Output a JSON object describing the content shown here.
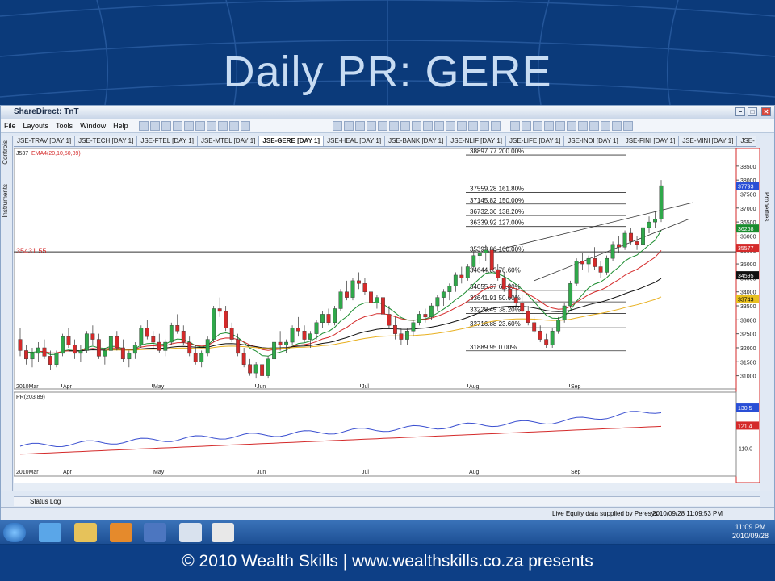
{
  "slide_title": "Daily PR: GERE",
  "footer": "© 2010 Wealth Skills | www.wealthskills.co.za presents",
  "app": {
    "title": "ShareDirect: TnT",
    "menu": [
      "File",
      "Layouts",
      "Tools",
      "Window",
      "Help"
    ],
    "tabs": [
      "JSE-TRAV [DAY 1]",
      "JSE-TECH [DAY 1]",
      "JSE-FTEL [DAY 1]",
      "JSE-MTEL [DAY 1]",
      "JSE-GERE [DAY 1]",
      "JSE-HEAL [DAY 1]",
      "JSE-BANK [DAY 1]",
      "JSE-NLIF [DAY 1]",
      "JSE-LIFE [DAY 1]",
      "JSE-INDI [DAY 1]",
      "JSE-FINI [DAY 1]",
      "JSE-MINI [DAY 1]",
      "JSE-"
    ],
    "active_tab": 4,
    "left_panels": [
      "Controls",
      "Instruments"
    ],
    "right_panels": [
      "Properties"
    ],
    "status_log": "Status Log",
    "feed_text": "Live Equity data supplied by Peresys",
    "datetime": "2010/09/28 11:09:53 PM"
  },
  "taskbar": {
    "time": "11:09 PM",
    "date": "2010/09/28"
  },
  "chart_data": [
    {
      "type": "candlestick",
      "indicator_label": "J537",
      "ema_label": "EMA4(20,10,50,89)",
      "y_ticks": [
        31000,
        31500,
        32000,
        32500,
        33000,
        33500,
        34000,
        34500,
        35000,
        35500,
        36000,
        36500,
        37000,
        37500,
        38000,
        38500
      ],
      "ylim": [
        30700,
        38900
      ],
      "x_labels": [
        "2010Mar",
        "Apr",
        "May",
        "Jun",
        "Jul",
        "Aug",
        "Sep"
      ],
      "level_line": {
        "label": "35431.55",
        "value": 35431.55
      },
      "price_badges": [
        {
          "value": "37793",
          "color": "#2a4fd6"
        },
        {
          "value": "36268",
          "color": "#1a8c2e"
        },
        {
          "value": "35577",
          "color": "#d42a2a"
        },
        {
          "value": "34595",
          "color": "#111111"
        },
        {
          "value": "33743",
          "color": "#e8c020"
        }
      ],
      "fib_levels": [
        {
          "price": 38897.77,
          "pct": "200.00%",
          "text": "38897.77 200.00%"
        },
        {
          "price": 37559.28,
          "pct": "161.80%",
          "text": "37559.28 161.80%"
        },
        {
          "price": 37145.82,
          "pct": "150.00%",
          "text": "37145.82 150.00%"
        },
        {
          "price": 36732.36,
          "pct": "138.20%",
          "text": "36732.36 138.20%"
        },
        {
          "price": 36339.92,
          "pct": "127.00%",
          "text": "36339.92 127.00%"
        },
        {
          "price": 35393.86,
          "pct": "100.00%",
          "text": "35393.86 100.00%"
        },
        {
          "price": 34644.03,
          "pct": "78.60%",
          "text": "34644.03 78.60%"
        },
        {
          "price": 34055.37,
          "pct": "61.80%",
          "text": "34055.37 61.80%"
        },
        {
          "price": 33641.91,
          "pct": "50.00%",
          "text": "33641.91 50.00%"
        },
        {
          "price": 33228.45,
          "pct": "38.20%",
          "text": "33228.45 38.20%"
        },
        {
          "price": 32716.88,
          "pct": "23.60%",
          "text": "32716.88 23.60%"
        },
        {
          "price": 31889.95,
          "pct": "0.00%",
          "text": "31889.95 0.00%"
        }
      ],
      "ohlc": [
        [
          32300,
          32700,
          31700,
          31900
        ],
        [
          31900,
          32100,
          31400,
          31600
        ],
        [
          31600,
          32000,
          31300,
          31800
        ],
        [
          31800,
          32200,
          31500,
          32000
        ],
        [
          32000,
          32300,
          31600,
          31700
        ],
        [
          31700,
          31900,
          31200,
          31400
        ],
        [
          31400,
          31900,
          31300,
          31800
        ],
        [
          31800,
          32500,
          31700,
          32400
        ],
        [
          32400,
          32700,
          32000,
          32100
        ],
        [
          32100,
          32300,
          31600,
          31800
        ],
        [
          31800,
          32100,
          31500,
          31900
        ],
        [
          31900,
          32600,
          31800,
          32500
        ],
        [
          32500,
          32800,
          32100,
          32300
        ],
        [
          32300,
          32500,
          31600,
          31700
        ],
        [
          31700,
          32000,
          31400,
          31900
        ],
        [
          31900,
          32500,
          31800,
          32400
        ],
        [
          32400,
          32600,
          31900,
          32000
        ],
        [
          32000,
          32300,
          31500,
          31600
        ],
        [
          31600,
          31900,
          31300,
          31800
        ],
        [
          31800,
          32200,
          31600,
          32100
        ],
        [
          32100,
          32800,
          32000,
          32700
        ],
        [
          32700,
          33000,
          32300,
          32400
        ],
        [
          32400,
          32600,
          32000,
          32200
        ],
        [
          32200,
          32500,
          31800,
          31900
        ],
        [
          31900,
          32300,
          31700,
          32200
        ],
        [
          32200,
          32900,
          32100,
          32800
        ],
        [
          32800,
          33200,
          32500,
          32600
        ],
        [
          32600,
          32800,
          32100,
          32200
        ],
        [
          32200,
          32400,
          31700,
          31800
        ],
        [
          31800,
          32100,
          31400,
          31500
        ],
        [
          31500,
          31900,
          31300,
          31800
        ],
        [
          31800,
          32400,
          31700,
          32300
        ],
        [
          32300,
          33500,
          32200,
          33400
        ],
        [
          33400,
          33800,
          33100,
          33300
        ],
        [
          33300,
          33500,
          32600,
          32700
        ],
        [
          32700,
          32900,
          32200,
          32300
        ],
        [
          32300,
          32500,
          31700,
          31800
        ],
        [
          31800,
          32000,
          31300,
          31400
        ],
        [
          31400,
          31600,
          31000,
          31100
        ],
        [
          31100,
          31500,
          30900,
          31400
        ],
        [
          31400,
          31700,
          30900,
          31000
        ],
        [
          31000,
          31700,
          30900,
          31600
        ],
        [
          31600,
          32300,
          31500,
          32200
        ],
        [
          32200,
          32600,
          31900,
          32100
        ],
        [
          32100,
          32300,
          31800,
          32200
        ],
        [
          32200,
          32800,
          32100,
          32700
        ],
        [
          32700,
          33100,
          32400,
          32600
        ],
        [
          32600,
          32800,
          32200,
          32300
        ],
        [
          32300,
          32600,
          32000,
          32500
        ],
        [
          32500,
          33000,
          32300,
          32900
        ],
        [
          32900,
          33300,
          32700,
          33200
        ],
        [
          33200,
          33400,
          32800,
          32900
        ],
        [
          32900,
          33500,
          32800,
          33400
        ],
        [
          33400,
          34100,
          33300,
          34000
        ],
        [
          34000,
          34400,
          33700,
          33800
        ],
        [
          33800,
          34500,
          33700,
          34400
        ],
        [
          34400,
          34700,
          34100,
          34300
        ],
        [
          34300,
          34500,
          33900,
          34000
        ],
        [
          34000,
          34200,
          33500,
          33600
        ],
        [
          33600,
          33900,
          33400,
          33800
        ],
        [
          33800,
          33900,
          33100,
          33200
        ],
        [
          33200,
          33500,
          32700,
          32800
        ],
        [
          32800,
          33100,
          32300,
          32500
        ],
        [
          32500,
          32700,
          32100,
          32300
        ],
        [
          32300,
          32700,
          32100,
          32600
        ],
        [
          32600,
          33000,
          32400,
          32900
        ],
        [
          32900,
          33300,
          32800,
          33200
        ],
        [
          33200,
          33400,
          32900,
          33100
        ],
        [
          33100,
          33600,
          33000,
          33500
        ],
        [
          33500,
          33900,
          33300,
          33800
        ],
        [
          33800,
          34100,
          33500,
          34000
        ],
        [
          34000,
          34300,
          33700,
          34200
        ],
        [
          34200,
          34700,
          34000,
          34600
        ],
        [
          34600,
          34900,
          34300,
          34500
        ],
        [
          34500,
          35000,
          34400,
          34900
        ],
        [
          34900,
          35500,
          34800,
          35300
        ],
        [
          35300,
          35600,
          35000,
          35400
        ],
        [
          35400,
          35700,
          35100,
          35500
        ],
        [
          35500,
          35600,
          34700,
          34800
        ],
        [
          34800,
          35000,
          34400,
          34500
        ],
        [
          34500,
          34700,
          34000,
          34100
        ],
        [
          34100,
          34300,
          33700,
          33800
        ],
        [
          33800,
          34100,
          33500,
          33600
        ],
        [
          33600,
          33900,
          33200,
          33300
        ],
        [
          33300,
          33500,
          32800,
          32900
        ],
        [
          32900,
          33100,
          32500,
          32600
        ],
        [
          32600,
          32800,
          32200,
          32300
        ],
        [
          32300,
          32500,
          32000,
          32100
        ],
        [
          32100,
          32700,
          32000,
          32600
        ],
        [
          32600,
          33100,
          32500,
          33000
        ],
        [
          33000,
          33600,
          32900,
          33500
        ],
        [
          33500,
          34400,
          33400,
          34300
        ],
        [
          34300,
          35200,
          34200,
          35100
        ],
        [
          35100,
          35400,
          34800,
          35000
        ],
        [
          35000,
          35300,
          34700,
          35200
        ],
        [
          35200,
          35600,
          34800,
          34900
        ],
        [
          34900,
          35100,
          34500,
          34700
        ],
        [
          34700,
          35300,
          34600,
          35200
        ],
        [
          35200,
          35800,
          35100,
          35700
        ],
        [
          35700,
          36000,
          35400,
          35600
        ],
        [
          35600,
          36200,
          35500,
          36100
        ],
        [
          36100,
          36300,
          35700,
          35800
        ],
        [
          35800,
          36000,
          35500,
          35700
        ],
        [
          35700,
          36400,
          35600,
          36300
        ],
        [
          36300,
          36700,
          36100,
          36500
        ],
        [
          36500,
          36900,
          36300,
          36600
        ],
        [
          36600,
          38000,
          36500,
          37800
        ]
      ]
    },
    {
      "type": "line",
      "indicator_label": "PR(203,89)",
      "y_ticks": [
        110.0,
        121.4,
        130.5
      ],
      "badges": [
        {
          "value": "130.5",
          "color": "#2a4fd6"
        },
        {
          "value": "121.4",
          "color": "#d42a2a"
        }
      ],
      "tick_label": "110.0",
      "x_labels": [
        "2010Mar",
        "Apr",
        "May",
        "Jun",
        "Jul",
        "Aug",
        "Sep"
      ]
    }
  ]
}
